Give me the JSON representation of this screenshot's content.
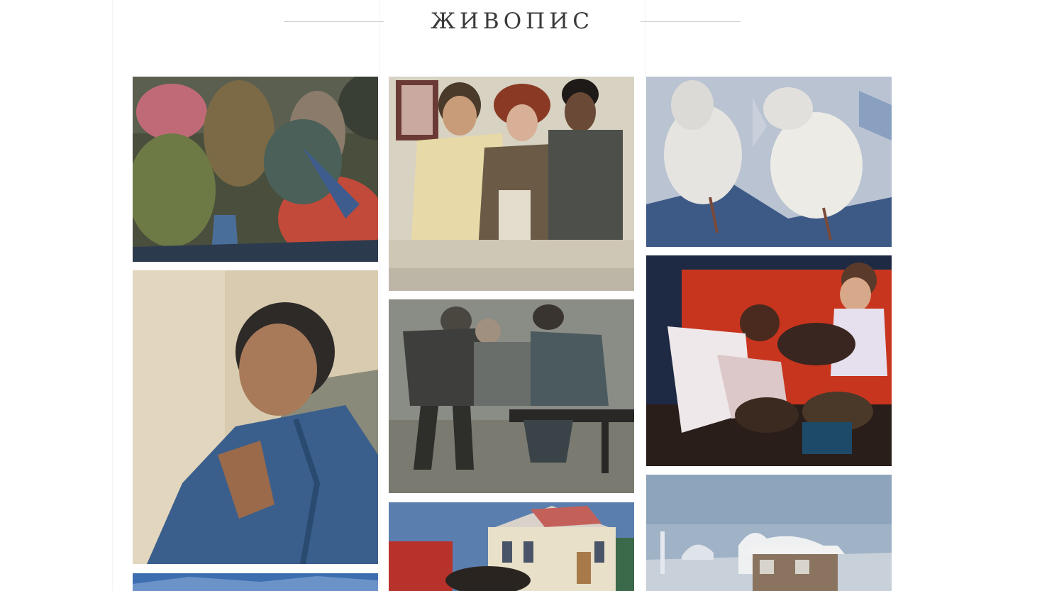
{
  "section": {
    "title": "ЖИВОПИС"
  },
  "gallery": {
    "items": [
      {
        "subject": "still-life-with-pumpkins-and-jugs"
      },
      {
        "subject": "three-figures-with-building-model"
      },
      {
        "subject": "white-geese"
      },
      {
        "subject": "self-portrait-in-blue-jacket"
      },
      {
        "subject": "workers-resting-on-bench"
      },
      {
        "subject": "women-with-bread-red-background"
      },
      {
        "subject": "snowy-street-with-horse-cart"
      },
      {
        "subject": "winter-landscape-with-hut"
      },
      {
        "subject": "blue-landscape"
      }
    ]
  },
  "colors": {
    "title": "#3a3a3a",
    "rule": "#cfcfcf",
    "background": "#ffffff"
  }
}
